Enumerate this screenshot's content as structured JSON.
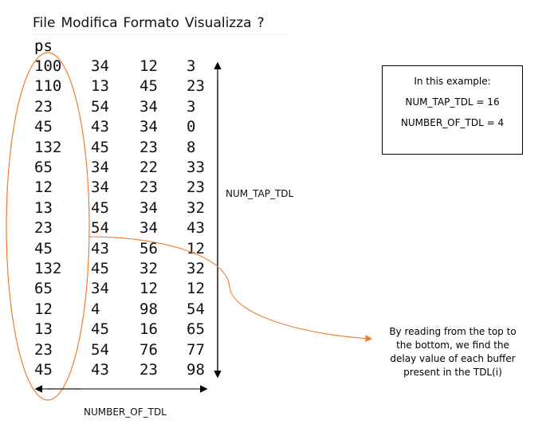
{
  "menu": [
    "File",
    "Modifica",
    "Formato",
    "Visualizza",
    "?"
  ],
  "unit": "ps",
  "rows": [
    [
      "100",
      "34",
      "12",
      "3"
    ],
    [
      "110",
      "13",
      "45",
      "23"
    ],
    [
      "23",
      "54",
      "34",
      "3"
    ],
    [
      "45",
      "43",
      "34",
      "0"
    ],
    [
      "132",
      "45",
      "23",
      "8"
    ],
    [
      "65",
      "34",
      "22",
      "33"
    ],
    [
      "12",
      "34",
      "23",
      "23"
    ],
    [
      "13",
      "45",
      "34",
      "32"
    ],
    [
      "23",
      "54",
      "34",
      "43"
    ],
    [
      "45",
      "43",
      "56",
      "12"
    ],
    [
      "132",
      "45",
      "32",
      "32"
    ],
    [
      "65",
      "34",
      "12",
      "12"
    ],
    [
      "12",
      "4",
      "98",
      "54"
    ],
    [
      "13",
      "45",
      "16",
      "65"
    ],
    [
      "23",
      "54",
      "76",
      "77"
    ],
    [
      "45",
      "43",
      "23",
      "98"
    ]
  ],
  "labels": {
    "vertical": "NUM_TAP_TDL",
    "horizontal": "NUMBER_OF_TDL"
  },
  "info_box": {
    "title": "In this example:",
    "line1": "NUM_TAP_TDL = 16",
    "line2": "NUMBER_OF_TDL = 4"
  },
  "note": "By reading from the top to the bottom, we find the delay value of each buffer present in the TDL(i)",
  "colors": {
    "accent": "#ED7D31"
  }
}
